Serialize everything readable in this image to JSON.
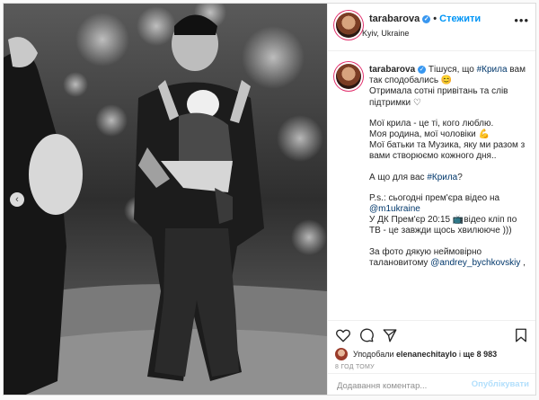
{
  "header": {
    "username": "tarabarova",
    "follow_label": "Стежити",
    "location": "Kyiv, Ukraine"
  },
  "caption": {
    "username": "tarabarova",
    "lines": {
      "l1a": "Тішуся, що ",
      "l1tag": "#Крила",
      "l1b": " вам так сподобались 😊",
      "l2": "Отримала сотні привітань та слів підтримки ♡",
      "l3": "Мої крила - це ті, кого люблю.",
      "l4": "Моя родина, мої чоловіки 💪",
      "l5": "Мої батьки та Музика, яку ми разом з вами створюємо кожного дня..",
      "l6a": "А що для вас ",
      "l6tag": "#Крила",
      "l6b": "?",
      "l7": "P.s.: сьогодні прем'єра відео на",
      "l8tag": "@m1ukraine",
      "l9": "У ДК Прем'єр 20:15 📺відео кліп по ТВ - це завжди щось хвилююче )))",
      "l10": "За фото дякую неймовірно талановитому ",
      "l10tag": "@andrey_bychkovskiy",
      "l10b": " ,"
    }
  },
  "actions": {
    "like_icon": "heart-icon",
    "comment_icon": "comment-icon",
    "share_icon": "share-icon",
    "save_icon": "bookmark-icon"
  },
  "likes": {
    "prefix": "Уподобали ",
    "user": "elenanechitaylo",
    "middle": " і ",
    "count": "ще 8 983"
  },
  "time_ago": "8 ГОД ТОМУ",
  "comment": {
    "placeholder": "Додавання коментар...",
    "publish_label": "Опублікувати"
  },
  "colors": {
    "accent": "#0095f6",
    "link": "#00376b",
    "publish_disabled": "#b2dffc",
    "verified": "#3897f0"
  }
}
